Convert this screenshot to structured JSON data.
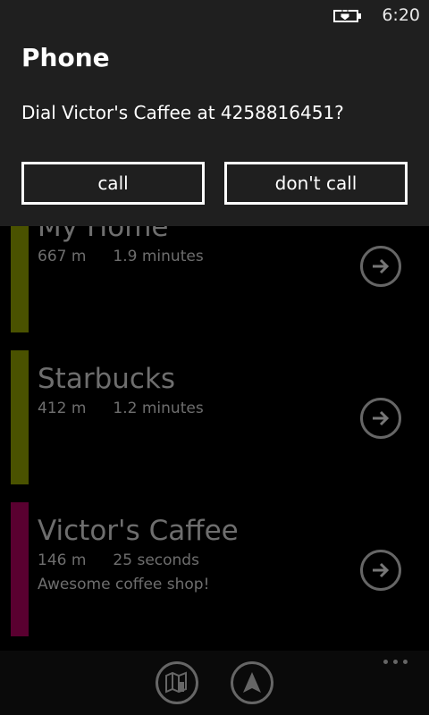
{
  "status": {
    "time": "6:20",
    "battery_icon": "battery-charging-icon"
  },
  "dialog": {
    "title": "Phone",
    "message": "Dial Victor's  Caffee at 4258816451?",
    "call_label": "call",
    "dont_call_label": "don't call"
  },
  "places": [
    {
      "name": "My Home",
      "distance": "667 m",
      "time": "1.9 minutes",
      "note": "",
      "color": "#4a5200"
    },
    {
      "name": "Starbucks",
      "distance": "412 m",
      "time": "1.2 minutes",
      "note": "",
      "color": "#4a5200"
    },
    {
      "name": "Victor's  Caffee",
      "distance": "146 m",
      "time": "25 seconds",
      "note": "Awesome coffee shop!",
      "color": "#5a0030"
    }
  ],
  "appbar": {
    "buttons": [
      "map-icon",
      "navigate-icon"
    ],
    "more": "more-icon"
  }
}
